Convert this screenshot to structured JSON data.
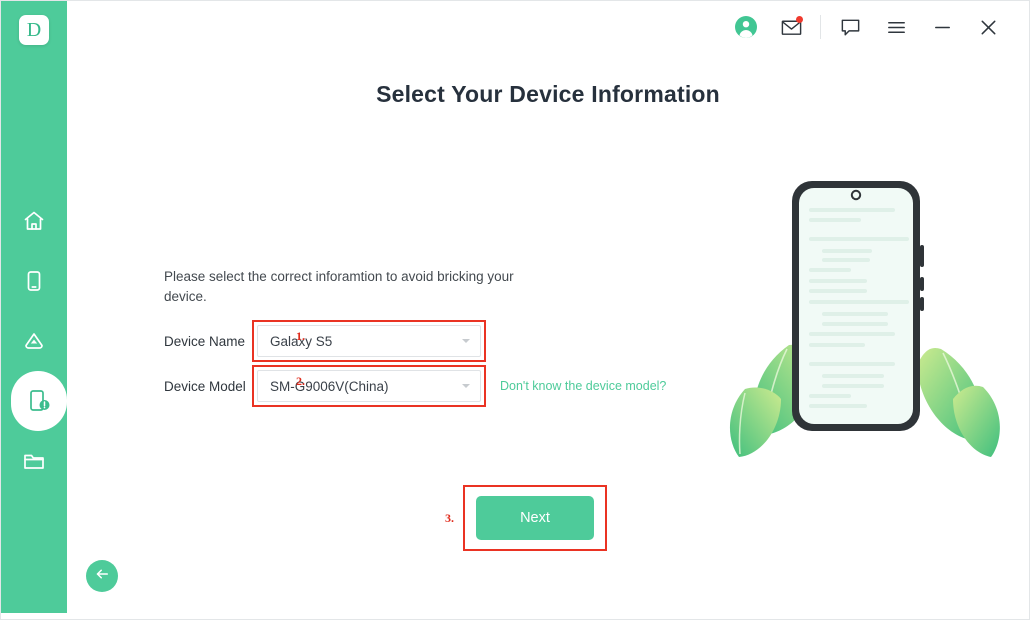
{
  "app": {
    "logo_letter": "D",
    "accent_green": "#4ecb9a",
    "marker_red": "#e02b1c",
    "title_color": "#27313d"
  },
  "titlebar": {
    "icons": [
      {
        "name": "account-avatar-icon",
        "label": "account"
      },
      {
        "name": "mail-icon",
        "label": "messages",
        "badge": true
      },
      {
        "name": "feedback-chat-icon",
        "label": "feedback"
      },
      {
        "name": "menu-icon",
        "label": "menu"
      },
      {
        "name": "minimize-icon",
        "label": "minimize"
      },
      {
        "name": "close-icon",
        "label": "close"
      }
    ]
  },
  "sidebar": {
    "items": [
      {
        "name": "home-icon",
        "label": "Home",
        "active": false
      },
      {
        "name": "phone-icon",
        "label": "Device",
        "active": false
      },
      {
        "name": "cloud-icon",
        "label": "Cloud",
        "active": false
      },
      {
        "name": "phone-alert-icon",
        "label": "System Repair",
        "active": true
      },
      {
        "name": "folder-icon",
        "label": "Files",
        "active": false
      }
    ]
  },
  "main": {
    "title": "Select Your Device Information",
    "intro": "Please select the correct inforamtion to avoid bricking your device.",
    "fields": [
      {
        "label": "Device Name",
        "value": "Galaxy S5",
        "marker": "1.",
        "highlighted": true
      },
      {
        "label": "Device Model",
        "value": "SM-G9006V(China)",
        "marker": "2.",
        "highlighted": true,
        "help_link": "Don't know the device model?"
      }
    ],
    "next_button": {
      "label": "Next",
      "marker": "3.",
      "highlighted": true
    },
    "back_button": {
      "name": "back-arrow-icon",
      "label": "Back"
    },
    "illustration": {
      "name": "phone-with-leaves-illustration",
      "description": "Smartphone with placeholder content lines flanked by green leaves"
    }
  }
}
